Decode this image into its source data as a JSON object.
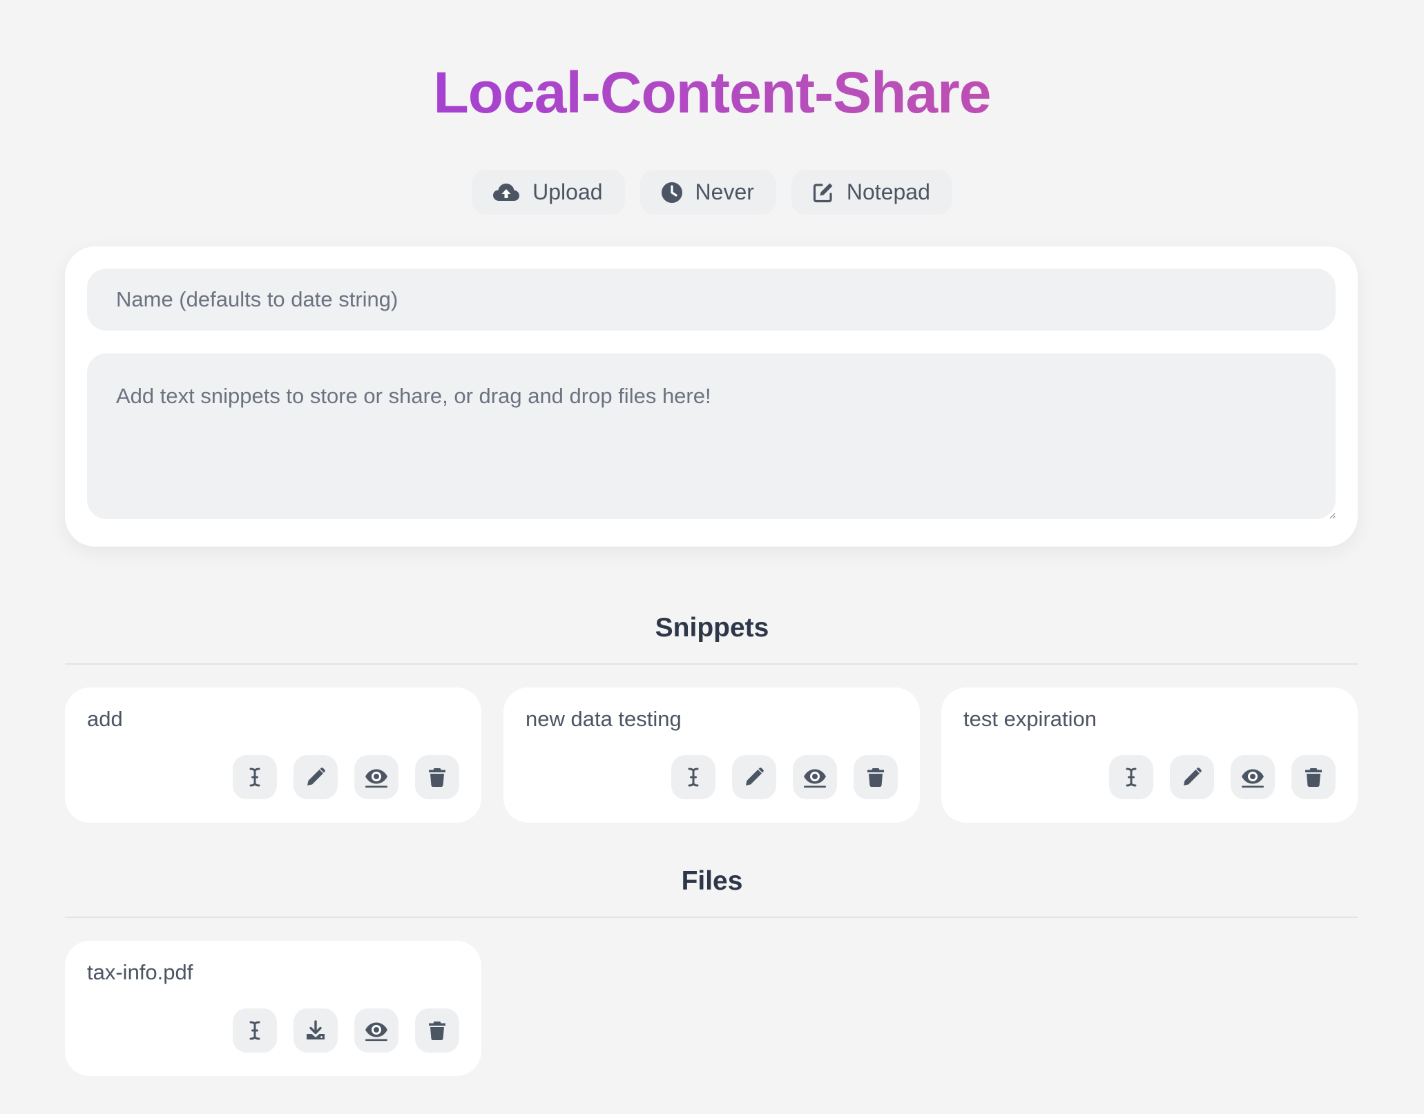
{
  "app": {
    "title": "Local-Content-Share"
  },
  "toolbar": {
    "buttons": [
      {
        "label": "Upload",
        "icon": "cloud-upload-icon"
      },
      {
        "label": "Never",
        "icon": "clock-icon"
      },
      {
        "label": "Notepad",
        "icon": "edit-icon"
      }
    ]
  },
  "form": {
    "name_placeholder": "Name (defaults to date string)",
    "name_value": "",
    "content_placeholder": "Add text snippets to store or share, or drag and drop files here!",
    "content_value": ""
  },
  "snippets": {
    "heading": "Snippets",
    "items": [
      {
        "name": "add",
        "actions": [
          "rename-icon",
          "edit-icon",
          "view-icon",
          "delete-icon"
        ]
      },
      {
        "name": "new data testing",
        "actions": [
          "rename-icon",
          "edit-icon",
          "view-icon",
          "delete-icon"
        ]
      },
      {
        "name": "test expiration",
        "actions": [
          "rename-icon",
          "edit-icon",
          "view-icon",
          "delete-icon"
        ]
      }
    ]
  },
  "files": {
    "heading": "Files",
    "items": [
      {
        "name": "tax-info.pdf",
        "actions": [
          "rename-icon",
          "download-icon",
          "view-icon",
          "delete-icon"
        ]
      }
    ]
  },
  "colors": {
    "title_gradient_start": "#9333ea",
    "title_gradient_end": "#d04f9e",
    "icon": "#4b5563",
    "background": "#f4f4f5"
  }
}
